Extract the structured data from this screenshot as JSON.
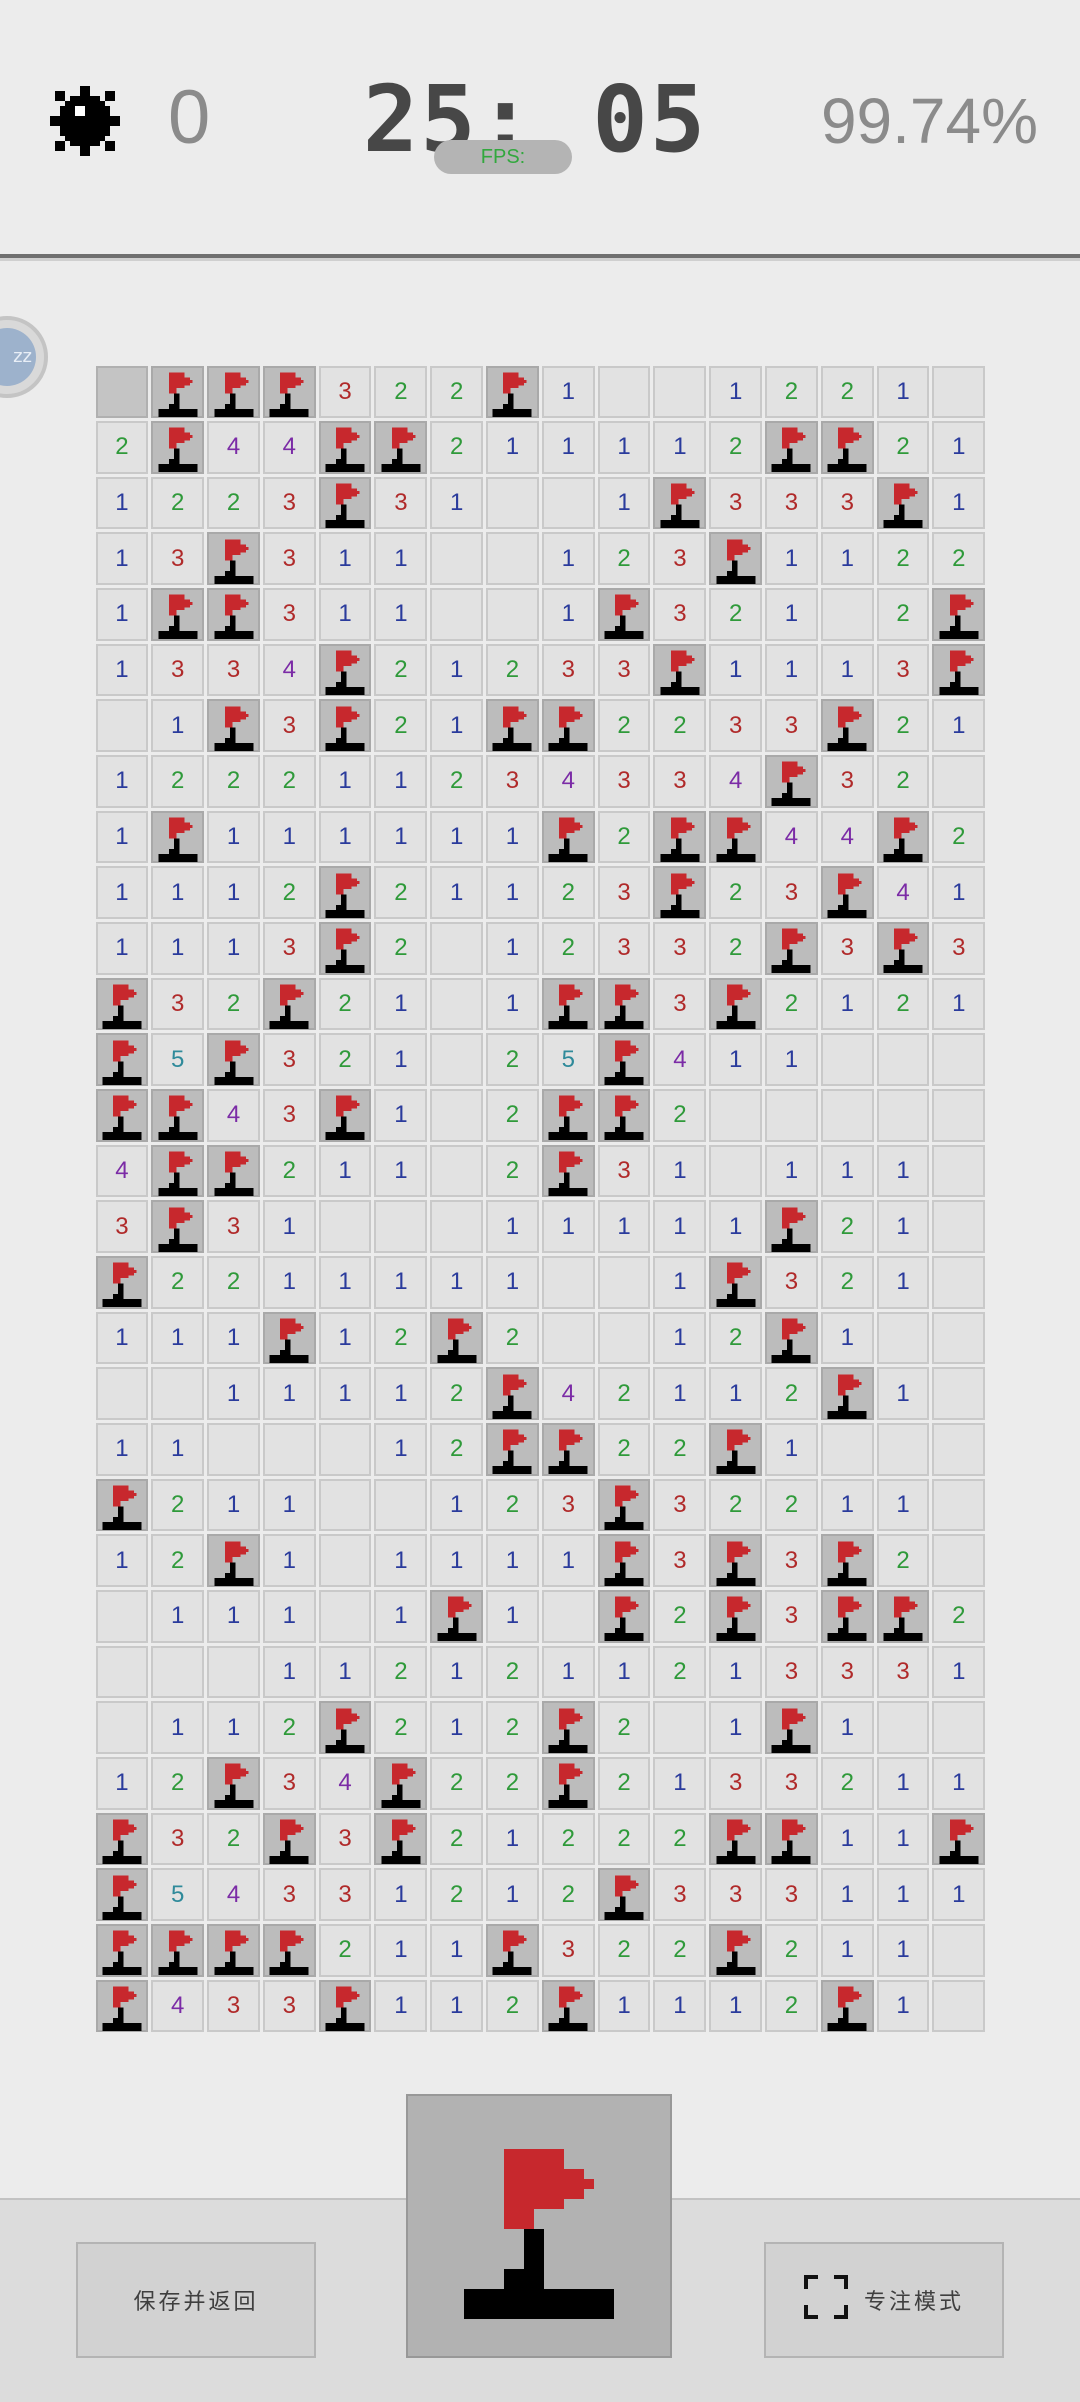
{
  "header": {
    "mines_remaining": "0",
    "timer": "25: 05",
    "fps_label": "FPS:",
    "progress": "99.74%"
  },
  "side_handle": {
    "label": "zz"
  },
  "board": {
    "cols": 16,
    "rows_count": 30,
    "legend": {
      "F": "flagged",
      "H": "hidden (unrevealed)",
      ".": "revealed empty",
      "1-8": "revealed number"
    },
    "number_colors": {
      "1": "#2a3b9c",
      "2": "#2f9a3a",
      "3": "#b02a2a",
      "4": "#7b2ba6",
      "5": "#2f8a9a",
      "6": "#1a8a8a",
      "7": "#333333",
      "8": "#777777"
    },
    "rows": [
      "HFFF322F1..1221.",
      "2F44FF211112FF21",
      "1223F31..1F333F1",
      "13F311..123F1122",
      "1FF311..1F321.2F",
      "1334F21233F1113F",
      ".1F3F21FF2233F21",
      "122211234334F32.",
      "1F111111F2FF44F2",
      "1112F21123F23F41",
      "1113F2.12332F3F3",
      "F32F21.1FF3F2121",
      "F5F321.25F411...",
      "FF43F1.2FF2.....",
      "4FF211.2F31.111.",
      "3F31...11111F21.",
      "F2211111..1F321.",
      "111F12F2..12F1..",
      "..11112F42112F1.",
      "11...12FF22F1...",
      "F211..123F32211.",
      "12F1.1111F3F3F2.",
      ".111.1F1.F2F3FF2",
      "...1121211213331",
      ".112F212F2.1F1..",
      "12F34F22F21332111",
      "F32F3F21222FF11F",
      "F54331212F333111",
      "FFFF211F322F211.",
      "F433F112F1112F1."
    ]
  },
  "controls": {
    "save_label": "保存并返回",
    "focus_label": "专注模式",
    "flag_mode_icon": "flag-icon",
    "focus_icon": "fullscreen-icon"
  }
}
